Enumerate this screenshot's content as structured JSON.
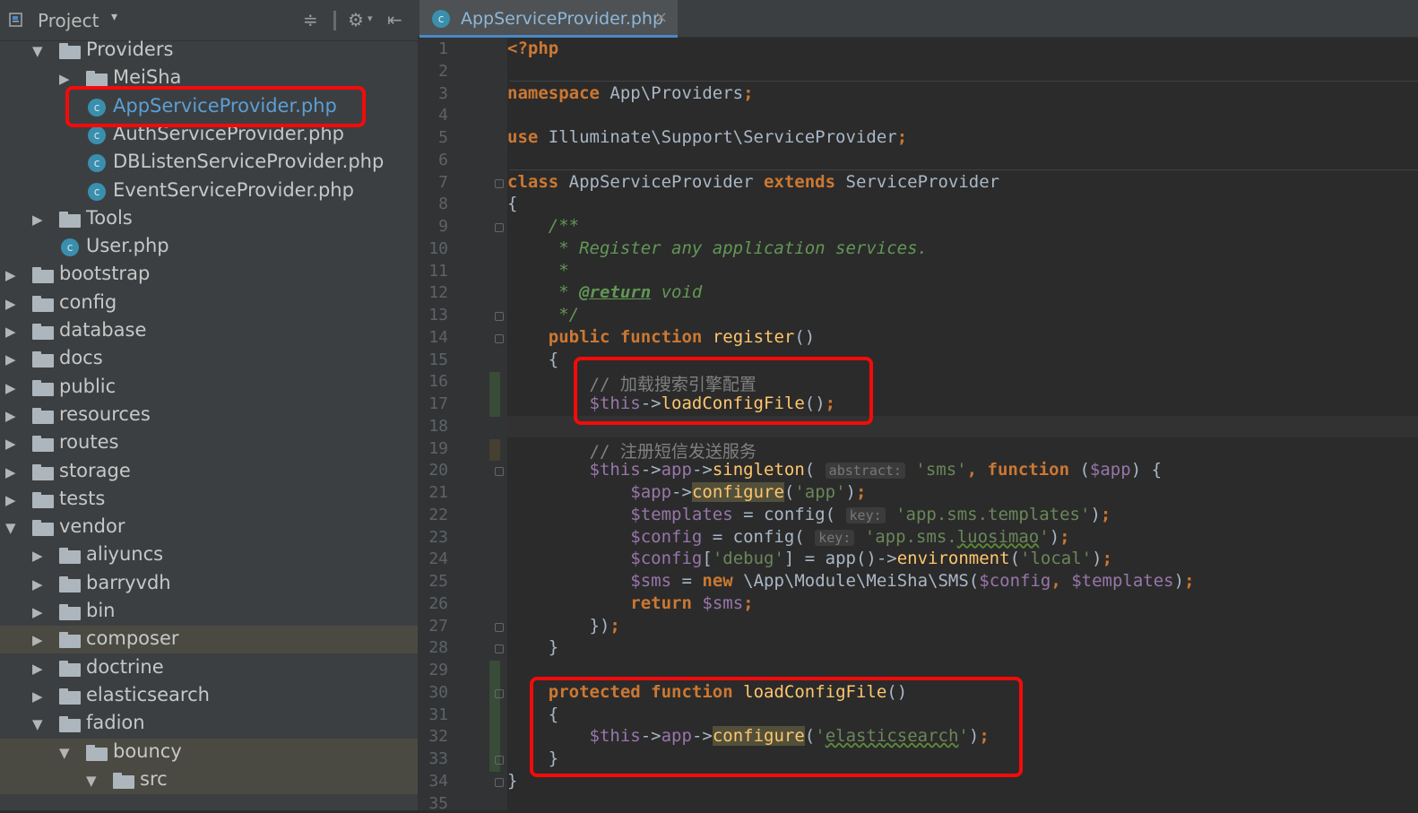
{
  "project_panel": {
    "title": "Project",
    "caret": "▾",
    "buttons": {
      "collapse": "≑",
      "settings": "⚙",
      "hide": "⇤"
    }
  },
  "tree": [
    {
      "label": "Providers",
      "type": "folder",
      "depth": 1,
      "expanded": true
    },
    {
      "label": "MeiSha",
      "type": "folder",
      "depth": 2,
      "expanded": false
    },
    {
      "label": "AppServiceProvider.php",
      "type": "class",
      "depth": 2,
      "selected": true
    },
    {
      "label": "AuthServiceProvider.php",
      "type": "class",
      "depth": 2
    },
    {
      "label": "DBListenServiceProvider.php",
      "type": "class",
      "depth": 2
    },
    {
      "label": "EventServiceProvider.php",
      "type": "class",
      "depth": 2
    },
    {
      "label": "Tools",
      "type": "folder",
      "depth": 1,
      "expanded": false
    },
    {
      "label": "User.php",
      "type": "class",
      "depth": 1
    },
    {
      "label": "bootstrap",
      "type": "folder",
      "depth": 0,
      "expanded": false
    },
    {
      "label": "config",
      "type": "folder",
      "depth": 0,
      "expanded": false
    },
    {
      "label": "database",
      "type": "folder",
      "depth": 0,
      "expanded": false
    },
    {
      "label": "docs",
      "type": "folder",
      "depth": 0,
      "expanded": false
    },
    {
      "label": "public",
      "type": "folder",
      "depth": 0,
      "expanded": false
    },
    {
      "label": "resources",
      "type": "folder",
      "depth": 0,
      "expanded": false
    },
    {
      "label": "routes",
      "type": "folder",
      "depth": 0,
      "expanded": false
    },
    {
      "label": "storage",
      "type": "folder",
      "depth": 0,
      "expanded": false
    },
    {
      "label": "tests",
      "type": "folder",
      "depth": 0,
      "expanded": false
    },
    {
      "label": "vendor",
      "type": "folder",
      "depth": 0,
      "expanded": true
    },
    {
      "label": "aliyuncs",
      "type": "folder",
      "depth": 1,
      "expanded": false
    },
    {
      "label": "barryvdh",
      "type": "folder",
      "depth": 1,
      "expanded": false
    },
    {
      "label": "bin",
      "type": "folder",
      "depth": 1,
      "expanded": false
    },
    {
      "label": "composer",
      "type": "folder",
      "depth": 1,
      "expanded": false,
      "dim": true
    },
    {
      "label": "doctrine",
      "type": "folder",
      "depth": 1,
      "expanded": false
    },
    {
      "label": "elasticsearch",
      "type": "folder",
      "depth": 1,
      "expanded": false
    },
    {
      "label": "fadion",
      "type": "folder",
      "depth": 1,
      "expanded": true
    },
    {
      "label": "bouncy",
      "type": "folder",
      "depth": 2,
      "expanded": true,
      "dim": true
    },
    {
      "label": "src",
      "type": "folder",
      "depth": 3,
      "expanded": true,
      "dim": true
    }
  ],
  "editor_tab": {
    "label": "AppServiceProvider.php",
    "close": "×",
    "icon_letter": "c"
  },
  "line_numbers": [
    "1",
    "2",
    "3",
    "4",
    "5",
    "6",
    "7",
    "8",
    "9",
    "10",
    "11",
    "12",
    "13",
    "14",
    "15",
    "16",
    "17",
    "18",
    "19",
    "20",
    "21",
    "22",
    "23",
    "24",
    "25",
    "26",
    "27",
    "28",
    "29",
    "30",
    "31",
    "32",
    "33",
    "34",
    "35"
  ],
  "code_lines": [
    "<span class=\"k\">&lt;?php</span>",
    "",
    "<span class=\"k\">namespace</span> App\\Providers<span class=\"k\">;</span>",
    "",
    "<span class=\"k\">use</span> Illuminate\\Support\\ServiceProvider<span class=\"k\">;</span>",
    "",
    "<span class=\"k\">class</span> AppServiceProvider <span class=\"k\">extends</span> ServiceProvider",
    "{",
    "    <span class=\"cm\">/**</span>",
    "<span class=\"cm\">     * Register any application services.</span>",
    "<span class=\"cm\">     *</span>",
    "<span class=\"cm\">     * </span><span class=\"tag\">@return</span><span class=\"cm\"> void</span>",
    "<span class=\"cm\">     */</span>",
    "    <span class=\"k\">public function</span> <span class=\"f\">register</span>()",
    "    {",
    "        <span class=\"cmt\">// 加载搜索引擎配置</span>",
    "        <span class=\"v\">$this</span>-&gt;<span class=\"f\">loadConfigFile</span>()<span class=\"k\">;</span>",
    "",
    "        <span class=\"cmt\">// 注册短信发送服务</span>",
    "        <span class=\"v\">$this</span>-&gt;<span class=\"v\">app</span>-&gt;<span class=\"f\">singleton</span>( <span class=\"hint\">abstract:</span> <span class=\"s\">'sms'</span><span class=\"k\">,</span> <span class=\"k\">function</span> (<span class=\"v\">$app</span>) {",
    "            <span class=\"v\">$app</span>-&gt;<span class=\"f hl\">configure</span>(<span class=\"s\">'app'</span>)<span class=\"k\">;</span>",
    "            <span class=\"v\">$templates</span> = config( <span class=\"hint\">key:</span> <span class=\"s\">'app.sms.templates'</span>)<span class=\"k\">;</span>",
    "            <span class=\"v\">$config</span> = config( <span class=\"hint\">key:</span> <span class=\"s\">'app.sms.<span class=\"typo\">luosimao</span>'</span>)<span class=\"k\">;</span>",
    "            <span class=\"v\">$config</span>[<span class=\"s\">'debug'</span>] = app()-&gt;<span class=\"f\">environment</span>(<span class=\"s\">'local'</span>)<span class=\"k\">;</span>",
    "            <span class=\"v\">$sms</span> = <span class=\"k\">new</span> \\App\\Module\\MeiSha\\SMS(<span class=\"v\">$config</span><span class=\"k\">,</span> <span class=\"v\">$templates</span>)<span class=\"k\">;</span>",
    "            <span class=\"k\">return</span> <span class=\"v\">$sms</span><span class=\"k\">;</span>",
    "        })<span class=\"k\">;</span>",
    "    }",
    "",
    "    <span class=\"k\">protected function</span> <span class=\"f\">loadConfigFile</span>()",
    "    {",
    "        <span class=\"v\">$this</span>-&gt;<span class=\"v\">app</span>-&gt;<span class=\"f hl\">configure</span>(<span class=\"s\">'<span class=\"typo\">elasticsearch</span>'</span>)<span class=\"k\">;</span>",
    "    }",
    "}",
    ""
  ]
}
